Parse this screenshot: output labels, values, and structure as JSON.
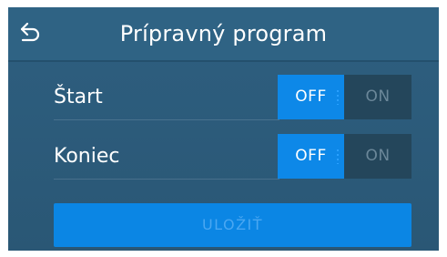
{
  "header": {
    "title": "Prípravný program",
    "back_icon": "back-arrow-icon"
  },
  "rows": [
    {
      "label": "Štart",
      "toggle": {
        "off_label": "OFF",
        "on_label": "ON",
        "selected": "OFF"
      }
    },
    {
      "label": "Koniec",
      "toggle": {
        "off_label": "OFF",
        "on_label": "ON",
        "selected": "OFF"
      }
    }
  ],
  "save": {
    "label": "ULOŽIŤ",
    "enabled": false
  },
  "colors": {
    "background": "#2e5f80",
    "accent": "#0d88e8",
    "toggle_inactive": "#24465b"
  }
}
